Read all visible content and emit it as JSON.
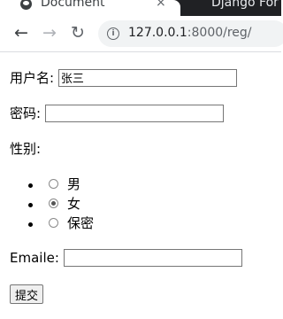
{
  "browser": {
    "active_tab_title": "Document",
    "inactive_tab_title": "Django For",
    "close_glyph": "×",
    "url_host": "127.0.0.1",
    "url_rest": ":8000/reg/"
  },
  "form": {
    "username_label": "用户名:",
    "username_value": "张三",
    "password_label": "密码:",
    "password_value": "",
    "gender_label": "性别:",
    "gender_options": [
      {
        "label": "男",
        "checked": false
      },
      {
        "label": "女",
        "checked": true
      },
      {
        "label": "保密",
        "checked": false
      }
    ],
    "email_label": "Emaile:",
    "email_value": "",
    "submit_label": "提交"
  }
}
